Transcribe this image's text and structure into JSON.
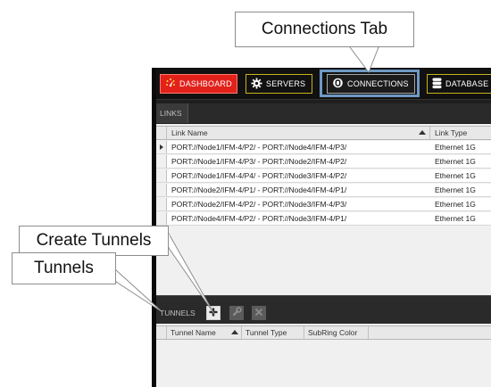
{
  "callouts": {
    "connections_tab": "Connections Tab",
    "create_tunnels": "Create Tunnels",
    "tunnels": "Tunnels"
  },
  "topbar": {
    "tabs": [
      {
        "label": "DASHBOARD",
        "icon": "dashboard-icon",
        "color": "#e3211b"
      },
      {
        "label": "SERVERS",
        "icon": "gear-icon"
      },
      {
        "label": "CONNECTIONS",
        "icon": "connections-icon"
      },
      {
        "label": "DATABASE",
        "icon": "database-icon"
      }
    ]
  },
  "links": {
    "section_label": "LINKS",
    "columns": [
      "Link Name",
      "Link Type"
    ],
    "rows": [
      {
        "name": "PORT://Node1/IFM-4/P2/ - PORT://Node4/IFM-4/P3/",
        "type": "Ethernet 1G"
      },
      {
        "name": "PORT://Node1/IFM-4/P3/ - PORT://Node2/IFM-4/P2/",
        "type": "Ethernet 1G"
      },
      {
        "name": "PORT://Node1/IFM-4/P4/ - PORT://Node3/IFM-4/P2/",
        "type": "Ethernet 1G"
      },
      {
        "name": "PORT://Node2/IFM-4/P1/ - PORT://Node4/IFM-4/P1/",
        "type": "Ethernet 1G"
      },
      {
        "name": "PORT://Node2/IFM-4/P2/ - PORT://Node3/IFM-4/P3/",
        "type": "Ethernet 1G"
      },
      {
        "name": "PORT://Node4/IFM-4/P2/ - PORT://Node3/IFM-4/P1/",
        "type": "Ethernet 1G"
      }
    ]
  },
  "tunnels": {
    "section_label": "TUNNELS",
    "columns": [
      "Tunnel Name",
      "Tunnel Type",
      "SubRing Color"
    ],
    "buttons": [
      "plus-icon",
      "wrench-icon",
      "close-icon"
    ]
  },
  "colors": {
    "highlight": "#6e99c4",
    "accent_yellow": "#c9b31b",
    "dashboard_red": "#e3211b"
  }
}
